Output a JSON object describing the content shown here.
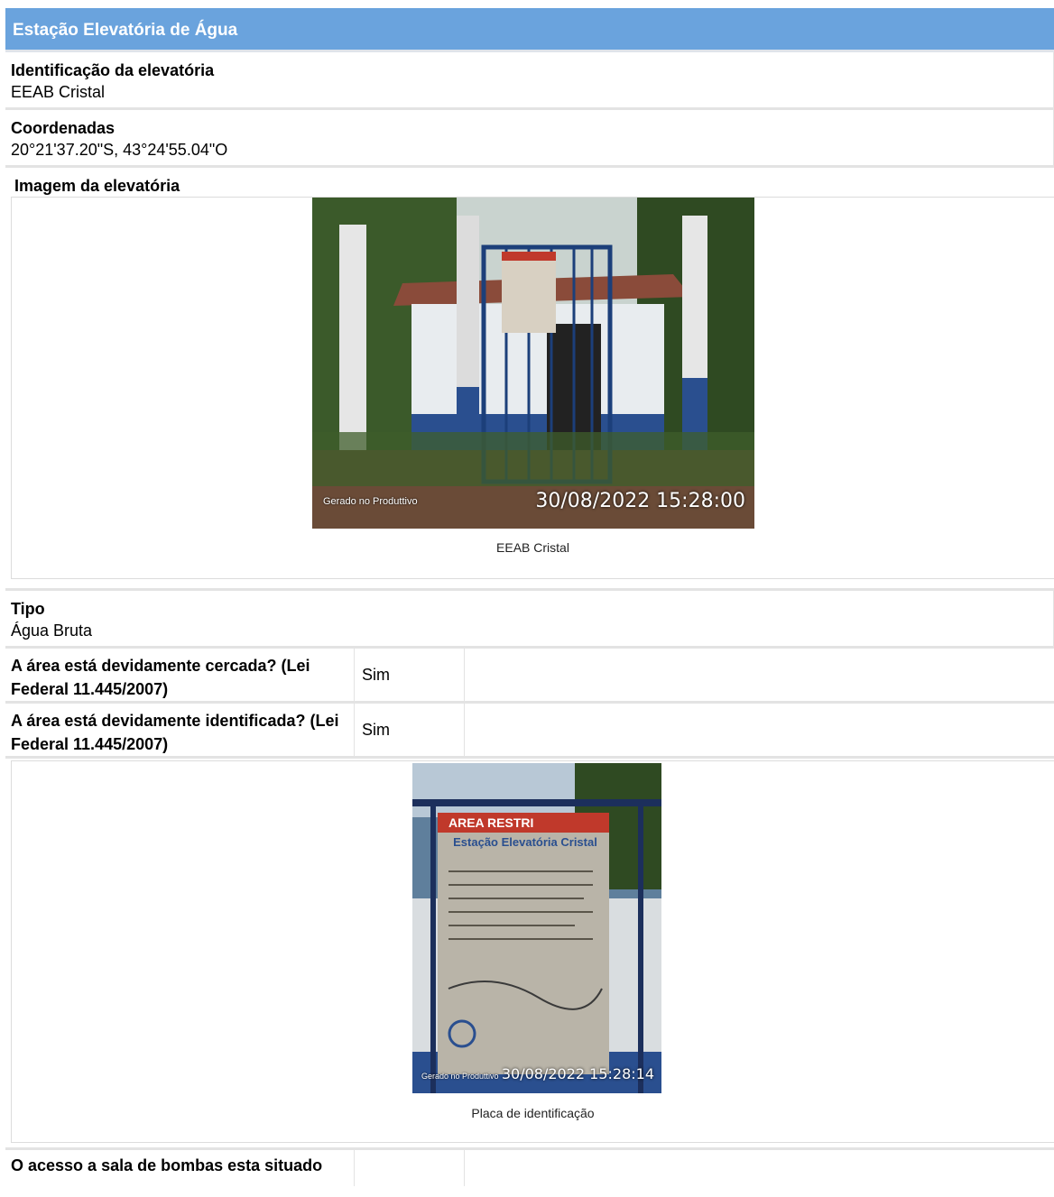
{
  "section": {
    "title": "Estação Elevatória de Água"
  },
  "identification": {
    "label": "Identificação da elevatória",
    "value": "EEAB Cristal"
  },
  "coordinates": {
    "label": "Coordenadas",
    "value": "20°21'37.20\"S, 43°24'55.04\"O"
  },
  "photo1": {
    "label": "Imagem da elevatória",
    "stamp_left": "Gerado no Produttivo",
    "stamp_right": "30/08/2022 15:28:00",
    "caption": "EEAB Cristal",
    "colors": {
      "sky": "#c9d3cf",
      "wall": "#e8ecef",
      "blue": "#2a4f8f",
      "ground": "#6a4b37",
      "foliage": "#3b5a2a"
    }
  },
  "tipo": {
    "label": "Tipo",
    "value": "Água Bruta"
  },
  "questions": [
    {
      "label": "A área está devidamente cercada? (Lei Federal 11.445/2007)",
      "answer": "Sim"
    },
    {
      "label": "A área está devidamente identificada? (Lei Federal 11.445/2007)",
      "answer": "Sim"
    }
  ],
  "photo2": {
    "sign_header": "AREA RESTRI",
    "sign_title": "Estação Elevatória Cristal",
    "stamp_left": "Gerado no Produttivo",
    "stamp_right": "30/08/2022 15:28:14",
    "caption": "Placa de identificação",
    "colors": {
      "sign": "#b9b4a8",
      "sign_red": "#c0392b",
      "fence": "#1c2f5c"
    }
  },
  "next_question": {
    "label": "O acesso a sala de bombas esta situado"
  }
}
